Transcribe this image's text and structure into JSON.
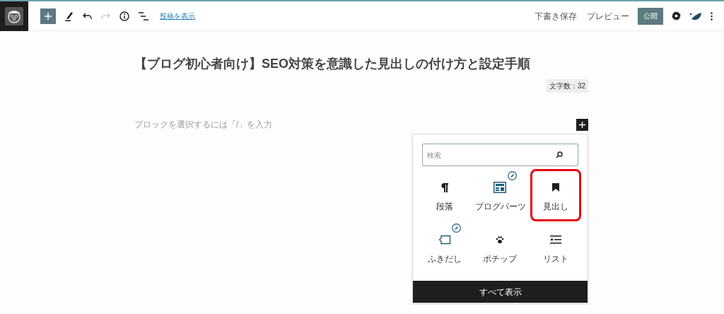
{
  "toolbar": {
    "view_post_link": "投稿を表示",
    "save_draft": "下書き保存",
    "preview": "プレビュー",
    "publish": "公開"
  },
  "editor": {
    "title": "【ブログ初心者向け】SEO対策を意識した見出しの付け方と設定手順",
    "word_count": "文字数：32",
    "block_placeholder": "ブロックを選択するには「/」を入力"
  },
  "inserter": {
    "search": {
      "placeholder": "検索"
    },
    "blocks": [
      {
        "kind": "paragraph",
        "label": "段落",
        "badge": false,
        "highlighted": false
      },
      {
        "kind": "layout",
        "label": "ブログパーツ",
        "badge": true,
        "highlighted": false
      },
      {
        "kind": "bookmark",
        "label": "見出し",
        "badge": false,
        "highlighted": true
      },
      {
        "kind": "bubble",
        "label": "ふきだし",
        "badge": true,
        "highlighted": false
      },
      {
        "kind": "paw",
        "label": "ポチップ",
        "badge": false,
        "highlighted": false
      },
      {
        "kind": "list",
        "label": "リスト",
        "badge": false,
        "highlighted": false
      }
    ],
    "browse_all": "すべて表示"
  }
}
